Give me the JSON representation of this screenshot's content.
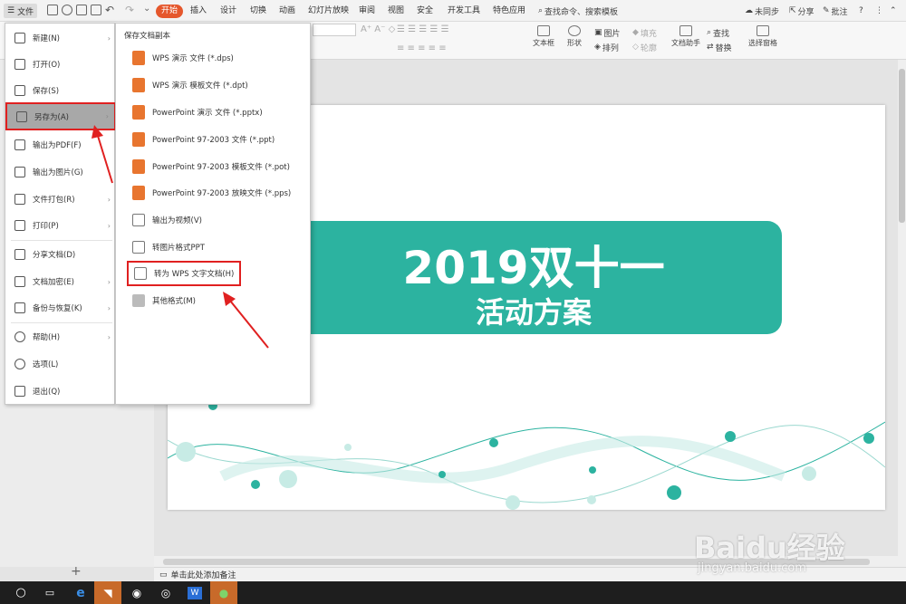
{
  "topbar": {
    "file_label": "文件",
    "tabs": [
      "开始",
      "插入",
      "设计",
      "切换",
      "动画",
      "幻灯片放映",
      "审阅",
      "视图",
      "安全",
      "开发工具",
      "特色应用"
    ],
    "search": "查找命令、搜索模板",
    "sync": "未同步",
    "share": "分享",
    "comment": "批注"
  },
  "ribbon": {
    "textbox": "文本框",
    "shape": "形状",
    "picture": "图片",
    "arrange": "排列",
    "fill": "填充",
    "outline": "轮廓",
    "doc_helper": "文档助手",
    "find": "查找",
    "replace": "替换",
    "select_pane": "选择窗格"
  },
  "file_menu": {
    "items": [
      "新建(N)",
      "打开(O)",
      "保存(S)",
      "另存为(A)",
      "输出为PDF(F)",
      "输出为图片(G)",
      "文件打包(R)",
      "打印(P)",
      "分享文档(D)",
      "文档加密(E)",
      "备份与恢复(K)",
      "帮助(H)",
      "选项(L)",
      "退出(Q)"
    ]
  },
  "submenu": {
    "header": "保存文档副本",
    "items": [
      "WPS 演示 文件 (*.dps)",
      "WPS 演示 模板文件 (*.dpt)",
      "PowerPoint 演示 文件 (*.pptx)",
      "PowerPoint 97-2003 文件 (*.ppt)",
      "PowerPoint 97-2003 模板文件 (*.pot)",
      "PowerPoint 97-2003 放映文件 (*.pps)",
      "输出为视频(V)",
      "转图片格式PPT",
      "转为 WPS 文字文档(H)",
      "其他格式(M)"
    ]
  },
  "slide": {
    "title": "2019双十一",
    "subtitle": "活动方案",
    "accent": "#2cb3a0"
  },
  "status": {
    "notes": "单击此处添加备注"
  },
  "watermark": {
    "brand": "Baidu经验",
    "url": "jingyan.baidu.com"
  },
  "colors": {
    "tab_active": "#e5572c",
    "highlight_box": "#e02020",
    "menu_selected": "#a8a8a8"
  }
}
